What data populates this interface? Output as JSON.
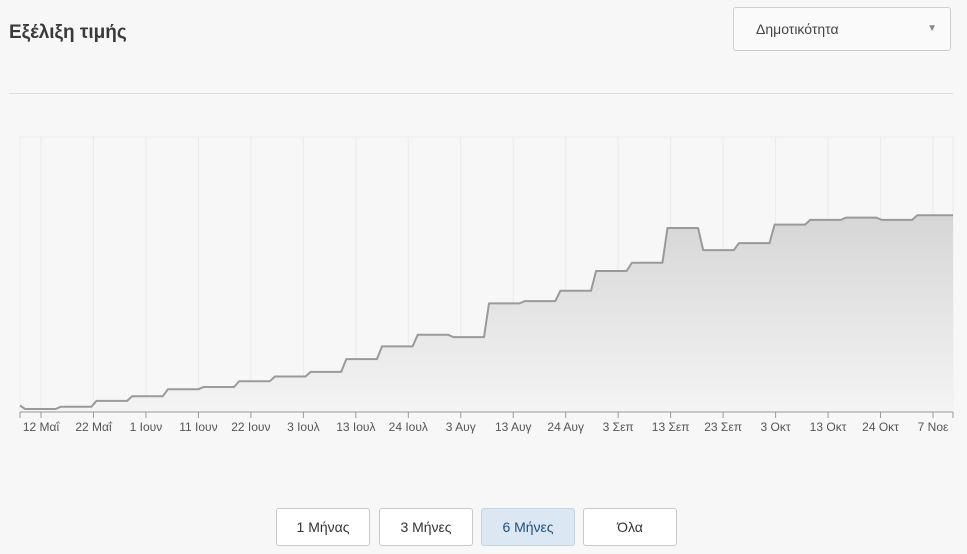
{
  "header": {
    "title": "Εξέλιξη τιμής",
    "sort_select": {
      "value": "Δημοτικότητα"
    }
  },
  "range_buttons": [
    {
      "label": "1 Μήνας",
      "active": false
    },
    {
      "label": "3 Μήνες",
      "active": false
    },
    {
      "label": "6 Μήνες",
      "active": true
    },
    {
      "label": "Όλα",
      "active": false
    }
  ],
  "chart_data": {
    "type": "area",
    "title": "",
    "xlabel": "",
    "ylabel": "",
    "grid": true,
    "x_tick_labels": [
      "12 Μαΐ",
      "22 Μαΐ",
      "1 Ιουν",
      "11 Ιουν",
      "22 Ιουν",
      "3 Ιουλ",
      "13 Ιουλ",
      "24 Ιουλ",
      "3 Αυγ",
      "13 Αυγ",
      "24 Αυγ",
      "3 Σεπ",
      "13 Σεπ",
      "23 Σεπ",
      "3 Οκτ",
      "13 Οκτ",
      "24 Οκτ",
      "7 Νοε"
    ],
    "x_range": [
      "2024-05-08",
      "2024-11-07"
    ],
    "y_range": [
      0,
      100
    ],
    "series": [
      {
        "points": [
          [
            "2024-05-08",
            1.5
          ],
          [
            "2024-05-09",
            0
          ],
          [
            "2024-05-15",
            0
          ],
          [
            "2024-05-16",
            1
          ],
          [
            "2024-05-22",
            1
          ],
          [
            "2024-05-23",
            3.5
          ],
          [
            "2024-05-29",
            3.5
          ],
          [
            "2024-05-30",
            5.5
          ],
          [
            "2024-06-05",
            5.5
          ],
          [
            "2024-06-06",
            8.5
          ],
          [
            "2024-06-12",
            8.5
          ],
          [
            "2024-06-13",
            9.5
          ],
          [
            "2024-06-19",
            9.5
          ],
          [
            "2024-06-20",
            12
          ],
          [
            "2024-06-26",
            12
          ],
          [
            "2024-06-27",
            14
          ],
          [
            "2024-07-03",
            14
          ],
          [
            "2024-07-04",
            16
          ],
          [
            "2024-07-10",
            16
          ],
          [
            "2024-07-11",
            21.5
          ],
          [
            "2024-07-17",
            21.5
          ],
          [
            "2024-07-18",
            27
          ],
          [
            "2024-07-24",
            27
          ],
          [
            "2024-07-25",
            32
          ],
          [
            "2024-07-31",
            32
          ],
          [
            "2024-08-01",
            31
          ],
          [
            "2024-08-07",
            31
          ],
          [
            "2024-08-08",
            45.5
          ],
          [
            "2024-08-14",
            45.5
          ],
          [
            "2024-08-15",
            46.5
          ],
          [
            "2024-08-21",
            46.5
          ],
          [
            "2024-08-22",
            51
          ],
          [
            "2024-08-28",
            51
          ],
          [
            "2024-08-29",
            59.5
          ],
          [
            "2024-09-04",
            59.5
          ],
          [
            "2024-09-05",
            63
          ],
          [
            "2024-09-11",
            63
          ],
          [
            "2024-09-12",
            78
          ],
          [
            "2024-09-18",
            78
          ],
          [
            "2024-09-19",
            68.5
          ],
          [
            "2024-09-25",
            68.5
          ],
          [
            "2024-09-26",
            71.5
          ],
          [
            "2024-10-02",
            71.5
          ],
          [
            "2024-10-03",
            79.5
          ],
          [
            "2024-10-09",
            79.5
          ],
          [
            "2024-10-10",
            81.5
          ],
          [
            "2024-10-16",
            81.5
          ],
          [
            "2024-10-17",
            82.5
          ],
          [
            "2024-10-23",
            82.5
          ],
          [
            "2024-10-24",
            81.5
          ],
          [
            "2024-10-30",
            81.5
          ],
          [
            "2024-10-31",
            83.5
          ],
          [
            "2024-11-07",
            83.5
          ]
        ]
      }
    ],
    "colors": {
      "line": "#9a9a9a",
      "fill_top": "#d6d6d6",
      "fill_bottom": "#f4f4f4"
    }
  }
}
